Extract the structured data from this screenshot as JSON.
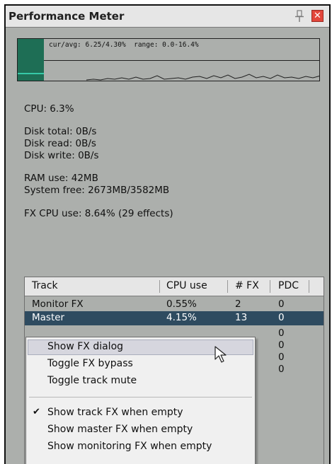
{
  "window": {
    "title": "Performance Meter"
  },
  "graph": {
    "label": "cur/avg: 6.25/4.30%  range: 0.0-16.4%",
    "current_cpu_percent": 6.25
  },
  "stats": {
    "cpu": "CPU: 6.3%",
    "disk_total": "Disk total: 0B/s",
    "disk_read": "Disk read: 0B/s",
    "disk_write": "Disk write: 0B/s",
    "ram_use": "RAM use: 42MB",
    "system_free": "System free: 2673MB/3582MB",
    "fx_cpu": "FX CPU use: 8.64% (29 effects)"
  },
  "table": {
    "columns": [
      "Track",
      "CPU use",
      "# FX",
      "PDC"
    ],
    "rows": [
      {
        "track": "Monitor FX",
        "cpu": "0.55%",
        "fx": "2",
        "pdc": "0"
      },
      {
        "track": "Master",
        "cpu": "4.15%",
        "fx": "13",
        "pdc": "0"
      }
    ],
    "extra_pdc": [
      "0",
      "0",
      "0",
      "0"
    ]
  },
  "context_menu": {
    "items": [
      "Show FX dialog",
      "Toggle FX bypass",
      "Toggle track mute",
      "Show track FX when empty",
      "Show master FX when empty",
      "Show monitoring FX when empty"
    ],
    "checkmark": "✔"
  },
  "colors": {
    "selected_row": "#2e4b60",
    "graph_bar": "#1e6e55",
    "close_button": "#e2463b"
  }
}
